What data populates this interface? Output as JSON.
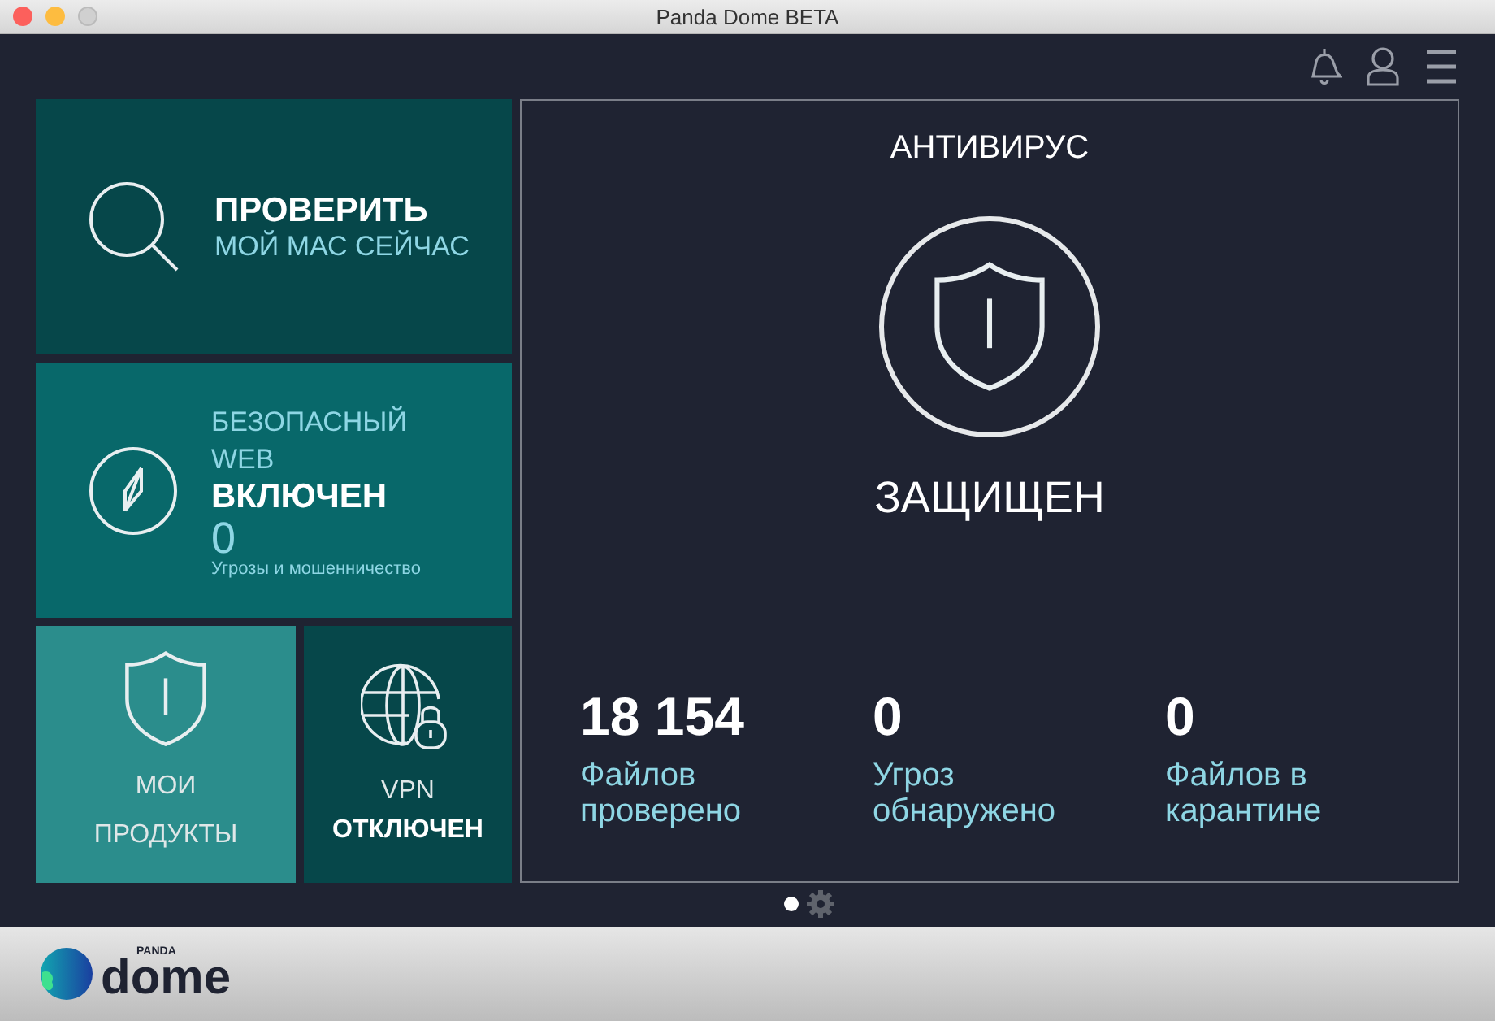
{
  "window": {
    "title": "Panda Dome BETA",
    "controls": [
      {
        "kind": "close",
        "disabled": false
      },
      {
        "kind": "minimize",
        "disabled": false
      },
      {
        "kind": "zoom",
        "disabled": true
      }
    ]
  },
  "toolbar": [
    {
      "kind": "bell"
    },
    {
      "kind": "user"
    },
    {
      "kind": "menu"
    }
  ],
  "tiles": [
    {
      "kind": "scan",
      "title": "ПРОВЕРИТЬ",
      "subtitle": "МОЙ МАС СЕЙЧАС"
    },
    {
      "kind": "web",
      "title": "БЕЗОПАСНЫЙ WEB",
      "status": "ВКЛЮЧЕН",
      "count": "0",
      "caption": "Угрозы и мошенничество"
    },
    {
      "kind": "products",
      "title": "МОИ ПРОДУКТЫ"
    },
    {
      "kind": "vpn",
      "title": "VPN",
      "status": "ОТКЛЮЧЕН"
    }
  ],
  "antivirus": {
    "title": "АНТИВИРУС",
    "status": "ЗАЩИЩЕН",
    "stats": [
      {
        "value": "18 154",
        "label": "Файлов проверено"
      },
      {
        "value": "0",
        "label": "Угроз обнаружено"
      },
      {
        "value": "0",
        "label": "Файлов в карантине"
      }
    ]
  },
  "pager": [
    {
      "kind": "dot",
      "selected": true
    },
    {
      "kind": "gear",
      "selected": false
    }
  ],
  "footer": {
    "brand_small": "PANDA",
    "brand": "dome"
  }
}
